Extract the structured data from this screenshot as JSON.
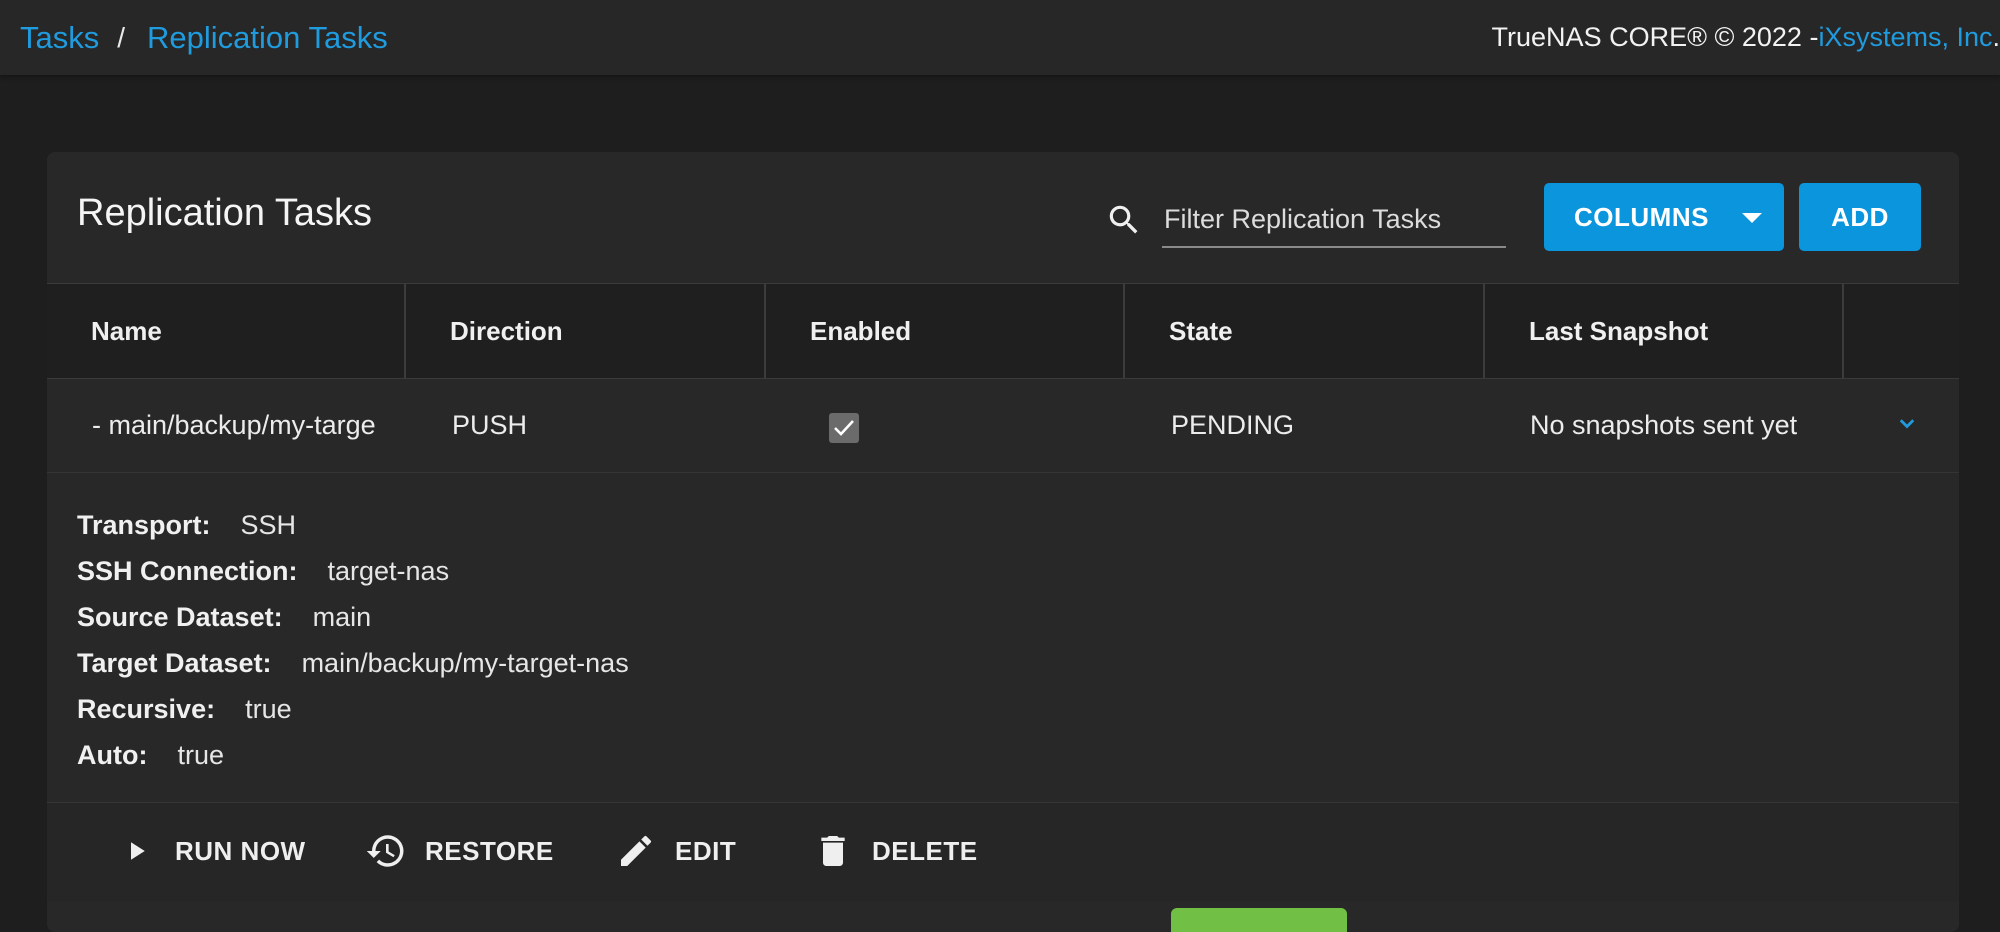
{
  "breadcrumb": {
    "items": [
      "Tasks",
      "Replication Tasks"
    ],
    "separator": "/"
  },
  "footer_copyright": {
    "text": "TrueNAS CORE® © 2022 - ",
    "vendor": "iXsystems, Inc",
    "suffix": "."
  },
  "card": {
    "title": "Replication Tasks",
    "filter_placeholder": "Filter Replication Tasks",
    "columns_button": "COLUMNS",
    "add_button": "ADD"
  },
  "table": {
    "headers": [
      "Name",
      "Direction",
      "Enabled",
      "State",
      "Last Snapshot"
    ],
    "rows": [
      {
        "name": "- main/backup/my-target-nas",
        "direction": "PUSH",
        "enabled": true,
        "state": "PENDING",
        "last_snapshot": "No snapshots sent yet"
      }
    ]
  },
  "details": [
    {
      "key": "Transport:",
      "value": "SSH"
    },
    {
      "key": "SSH Connection:",
      "value": "target-nas"
    },
    {
      "key": "Source Dataset:",
      "value": "main"
    },
    {
      "key": "Target Dataset:",
      "value": "main/backup/my-target-nas"
    },
    {
      "key": "Recursive:",
      "value": "true"
    },
    {
      "key": "Auto:",
      "value": "true"
    }
  ],
  "actions": {
    "run_now": "RUN NOW",
    "restore": "RESTORE",
    "edit": "EDIT",
    "delete": "DELETE"
  },
  "icons": {
    "search": "search-icon",
    "dropdown": "caret-down-icon",
    "checkbox": "check-icon",
    "expand": "chevron-down-icon",
    "run_now": "play-icon",
    "restore": "history-icon",
    "edit": "pencil-icon",
    "delete": "trash-icon"
  },
  "colors": {
    "accent": "#0b95dc",
    "link": "#1f9bde",
    "background": "#1e1e1e",
    "card": "#282828",
    "status_green": "#71bf44"
  }
}
